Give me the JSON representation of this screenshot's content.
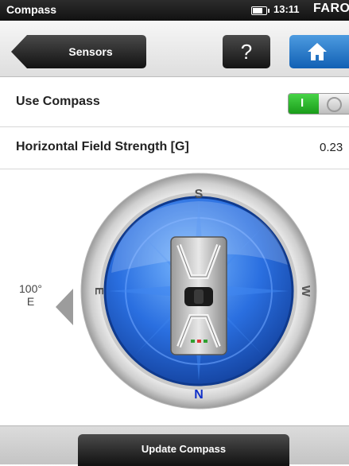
{
  "status_bar": {
    "app_title": "Compass",
    "time": "13:11",
    "brand": "FARO"
  },
  "toolbar": {
    "back_label": "Sensors",
    "help_label": "?",
    "home_icon": "home-icon"
  },
  "settings": {
    "use_compass_label": "Use Compass",
    "use_compass_toggle": "I",
    "use_compass_on": true,
    "field_strength_label": "Horizontal Field Strength [G]",
    "field_strength_value": "0.23"
  },
  "compass": {
    "heading_degrees": "100°",
    "heading_direction": "E",
    "dial_labels": {
      "top": "S",
      "left": "E",
      "right": "W",
      "bottom": "N"
    }
  },
  "footer": {
    "update_label": "Update Compass"
  },
  "colors": {
    "toggle_on": "#2cb52c",
    "home_button": "#1c72c8",
    "dial_blue": "#1f5fd6",
    "north_label": "#1030c8"
  }
}
